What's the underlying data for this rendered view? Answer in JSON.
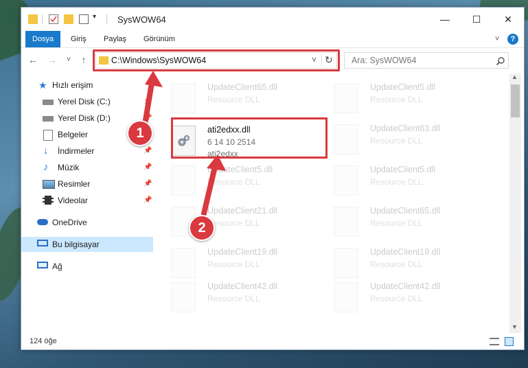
{
  "window": {
    "title": "SysWOW64",
    "minimize_glyph": "—",
    "maximize_glyph": "☐",
    "close_glyph": "✕"
  },
  "ribbon": {
    "tabs": [
      {
        "label": "Dosya",
        "active": true
      },
      {
        "label": "Giriş",
        "active": false
      },
      {
        "label": "Paylaş",
        "active": false
      },
      {
        "label": "Görünüm",
        "active": false
      }
    ],
    "expand_glyph": "˅",
    "help_glyph": "?"
  },
  "nav": {
    "back_glyph": "←",
    "forward_glyph": "→",
    "recent_glyph": "˅",
    "up_glyph": "↑",
    "address": "C:\\Windows\\SysWOW64",
    "address_dropdown_glyph": "˅",
    "refresh_glyph": "↻",
    "search_placeholder": "Ara: SysWOW64"
  },
  "sidebar": {
    "items": [
      {
        "label": "Hızlı erişim",
        "icon": "star-icon",
        "pinned": false,
        "selected": false
      },
      {
        "label": "Yerel Disk (C:)",
        "icon": "drive-icon",
        "pinned": true,
        "selected": false
      },
      {
        "label": "Yerel Disk (D:)",
        "icon": "drive-icon",
        "pinned": true,
        "selected": false
      },
      {
        "label": "Belgeler",
        "icon": "documents-icon",
        "pinned": true,
        "selected": false
      },
      {
        "label": "İndirmeler",
        "icon": "download-icon",
        "pinned": true,
        "selected": false
      },
      {
        "label": "Müzik",
        "icon": "music-icon",
        "pinned": true,
        "selected": false
      },
      {
        "label": "Resimler",
        "icon": "pictures-icon",
        "pinned": true,
        "selected": false
      },
      {
        "label": "Videolar",
        "icon": "videos-icon",
        "pinned": true,
        "selected": false
      },
      {
        "label": "OneDrive",
        "icon": "cloud-icon",
        "pinned": false,
        "selected": false
      },
      {
        "label": "Bu bilgisayar",
        "icon": "computer-icon",
        "pinned": false,
        "selected": true
      },
      {
        "label": "Ağ",
        "icon": "network-icon",
        "pinned": false,
        "selected": false
      }
    ],
    "pin_glyph": "📌"
  },
  "files": {
    "left": [
      {
        "name": "UpdateClient65.dll",
        "type": "Resource DLL",
        "desc": ""
      },
      {
        "name": "ati2edxx.dll",
        "type": "6 14 10 2514",
        "desc": "ati2edxx"
      },
      {
        "name": "UpdateClient5.dll",
        "type": "Resource DLL",
        "desc": ""
      },
      {
        "name": "UpdateClient21.dll",
        "type": "Resource DLL",
        "desc": ""
      },
      {
        "name": "UpdateClient19.dll",
        "type": "Resource DLL",
        "desc": ""
      },
      {
        "name": "UpdateClient42.dll",
        "type": "Resource DLL",
        "desc": ""
      }
    ],
    "right": [
      {
        "name": "UpdateClient5.dll",
        "type": "Resource DLL"
      },
      {
        "name": "UpdateClient63.dll",
        "type": "Resource DLL"
      },
      {
        "name": "UpdateClient5.dll",
        "type": "Resource DLL"
      },
      {
        "name": "UpdateClient65.dll",
        "type": "Resource DLL"
      },
      {
        "name": "UpdateClient19.dll",
        "type": "Resource DLL"
      },
      {
        "name": "UpdateClient42.dll",
        "type": "Resource DLL"
      }
    ]
  },
  "status": {
    "count": "124 öğe"
  },
  "callouts": {
    "one": "1",
    "two": "2"
  },
  "colors": {
    "accent": "#1979ca",
    "highlight": "#d9393f",
    "selected_bg": "#cce8ff"
  }
}
